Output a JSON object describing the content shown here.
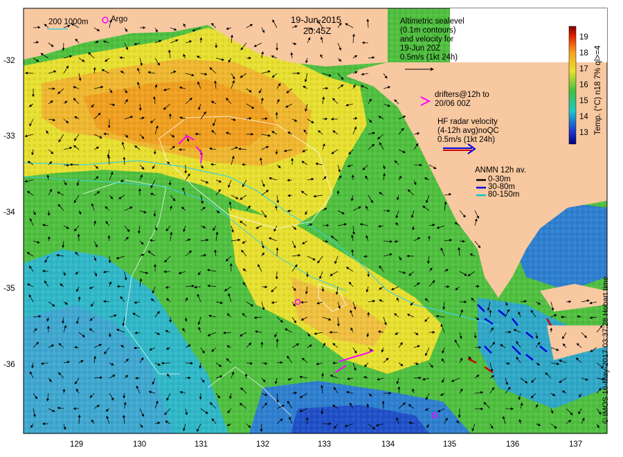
{
  "map": {
    "date": "19-Jun-2015",
    "time": "20:45Z",
    "depth_legend": "200  1000m",
    "argo_label": "Argo",
    "altimetry_note": [
      "Altimetric sealevel",
      "(0.1m contours)",
      "and velocity for",
      "19-Jun 20Z",
      "0.5m/s (1kt 24h)"
    ],
    "drifters_note": [
      "drifters@12h to",
      "20/06 00Z"
    ],
    "hf_note": [
      "HF radar velocity",
      "(4-12h avg)noQC",
      "0.5m/s (1kt 24h)"
    ],
    "anmn_title": "ANMN 12h av.",
    "anmn_items": [
      {
        "label": "0-30m",
        "color": "#000000"
      },
      {
        "label": "30-80m",
        "color": "#0000dd"
      },
      {
        "label": "80-150m",
        "color": "#00c8c8"
      }
    ],
    "x_ticks": [
      "129",
      "130",
      "131",
      "132",
      "133",
      "134",
      "135",
      "136",
      "137"
    ],
    "y_ticks": [
      "-32",
      "-33",
      "-34",
      "-35",
      "-36"
    ],
    "colorbar_ticks": [
      "19",
      "18",
      "17",
      "16",
      "15",
      "14",
      "13"
    ],
    "colorbar_title": "Temp. (°C) n18 7% ql>=4",
    "credit": "© IMOS 16-May-2017 03:37:28 Hobart time",
    "colors": {
      "land": "#f8c8a0",
      "warm": "#f0a020",
      "mid": "#e8e030",
      "green": "#50c040",
      "cool": "#30b8c8",
      "cold": "#1e50c8",
      "drifter": "#ff00ff"
    }
  }
}
